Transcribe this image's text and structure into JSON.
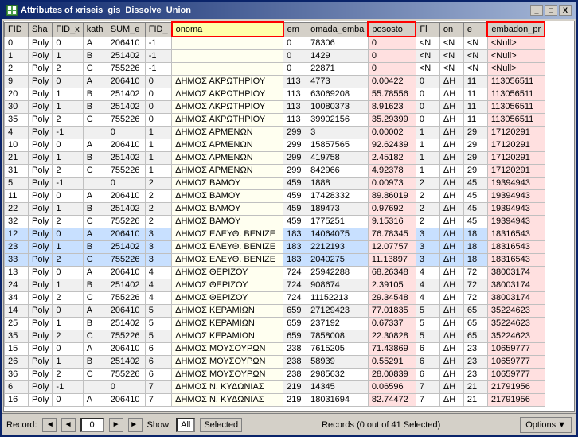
{
  "window": {
    "title": "Attributes of xriseis_gis_Dissolve_Union",
    "icon": "table-icon"
  },
  "title_buttons": {
    "minimize": "_",
    "maximize": "□",
    "close": "X"
  },
  "columns": [
    "FID",
    "Sha",
    "FID_x",
    "kath",
    "SUM_e",
    "FID_",
    "onoma",
    "em",
    "omada_emba",
    "pososto",
    "Fl",
    "on",
    "e",
    "embadon_pr"
  ],
  "rows": [
    [
      0,
      "Poly",
      0,
      "A",
      206410,
      -1,
      "",
      0,
      78306,
      0,
      "<N",
      "<N",
      "<N",
      "<Null>"
    ],
    [
      1,
      "Poly",
      1,
      "B",
      251402,
      -1,
      "",
      0,
      1429,
      0,
      "<N",
      "<N",
      "<N",
      "<Null>"
    ],
    [
      2,
      "Poly",
      2,
      "C",
      755226,
      -1,
      "",
      0,
      22871,
      0,
      "<N",
      "<N",
      "<N",
      "<Null>"
    ],
    [
      9,
      "Poly",
      0,
      "A",
      206410,
      0,
      "ΔΗΜΟΣ ΑΚΡΩΤΗΡΙΟΥ",
      113,
      4773,
      0.00422,
      0,
      "ΔΗ",
      11,
      113056511
    ],
    [
      20,
      "Poly",
      1,
      "B",
      251402,
      0,
      "ΔΗΜΟΣ ΑΚΡΩΤΗΡΙΟΥ",
      113,
      63069208,
      55.78556,
      0,
      "ΔΗ",
      11,
      113056511
    ],
    [
      30,
      "Poly",
      1,
      "B",
      251402,
      0,
      "ΔΗΜΟΣ ΑΚΡΩΤΗΡΙΟΥ",
      113,
      10080373,
      8.91623,
      0,
      "ΔΗ",
      11,
      113056511
    ],
    [
      35,
      "Poly",
      2,
      "C",
      755226,
      0,
      "ΔΗΜΟΣ ΑΚΡΩΤΗΡΙΟΥ",
      113,
      39902156,
      35.29399,
      0,
      "ΔΗ",
      11,
      113056511
    ],
    [
      4,
      "Poly",
      -1,
      "",
      0,
      1,
      "ΔΗΜΟΣ ΑΡΜΕΝΩΝ",
      299,
      3,
      2e-05,
      1,
      "ΔΗ",
      29,
      17120291
    ],
    [
      10,
      "Poly",
      0,
      "A",
      206410,
      1,
      "ΔΗΜΟΣ ΑΡΜΕΝΩΝ",
      299,
      15857565,
      92.62439,
      1,
      "ΔΗ",
      29,
      17120291
    ],
    [
      21,
      "Poly",
      1,
      "B",
      251402,
      1,
      "ΔΗΜΟΣ ΑΡΜΕΝΩΝ",
      299,
      419758,
      2.45182,
      1,
      "ΔΗ",
      29,
      17120291
    ],
    [
      31,
      "Poly",
      2,
      "C",
      755226,
      1,
      "ΔΗΜΟΣ ΑΡΜΕΝΩΝ",
      299,
      842966,
      4.92378,
      1,
      "ΔΗ",
      29,
      17120291
    ],
    [
      5,
      "Poly",
      -1,
      "",
      0,
      2,
      "ΔΗΜΟΣ ΒΑΜΟΥ",
      459,
      1888,
      0.00973,
      2,
      "ΔΗ",
      45,
      19394943
    ],
    [
      11,
      "Poly",
      0,
      "A",
      206410,
      2,
      "ΔΗΜΟΣ ΒΑΜΟΥ",
      459,
      17428332,
      89.86019,
      2,
      "ΔΗ",
      45,
      19394943
    ],
    [
      22,
      "Poly",
      1,
      "B",
      251402,
      2,
      "ΔΗΜΟΣ ΒΑΜΟΥ",
      459,
      189473,
      0.97692,
      2,
      "ΔΗ",
      45,
      19394943
    ],
    [
      32,
      "Poly",
      2,
      "C",
      755226,
      2,
      "ΔΗΜΟΣ ΒΑΜΟΥ",
      459,
      1775251,
      9.15316,
      2,
      "ΔΗ",
      45,
      19394943
    ],
    [
      12,
      "Poly",
      0,
      "A",
      206410,
      3,
      "ΔΗΜΟΣ ΕΛΕΥΘ. ΒΕΝΙΖΕ",
      183,
      14064075,
      76.78345,
      3,
      "ΔΗ",
      18,
      18316543
    ],
    [
      23,
      "Poly",
      1,
      "B",
      251402,
      3,
      "ΔΗΜΟΣ ΕΛΕΥΘ. ΒΕΝΙΖΕ",
      183,
      2212193,
      12.07757,
      3,
      "ΔΗ",
      18,
      18316543
    ],
    [
      33,
      "Poly",
      2,
      "C",
      755226,
      3,
      "ΔΗΜΟΣ ΕΛΕΥΘ. ΒΕΝΙΖΕ",
      183,
      2040275,
      11.13897,
      3,
      "ΔΗ",
      18,
      18316543
    ],
    [
      13,
      "Poly",
      0,
      "A",
      206410,
      4,
      "ΔΗΜΟΣ ΘΕΡΙΖΟΥ",
      724,
      25942288,
      68.26348,
      4,
      "ΔΗ",
      72,
      38003174
    ],
    [
      24,
      "Poly",
      1,
      "B",
      251402,
      4,
      "ΔΗΜΟΣ ΘΕΡΙΖΟΥ",
      724,
      908674,
      2.39105,
      4,
      "ΔΗ",
      72,
      38003174
    ],
    [
      34,
      "Poly",
      2,
      "C",
      755226,
      4,
      "ΔΗΜΟΣ ΘΕΡΙΖΟΥ",
      724,
      11152213,
      29.34548,
      4,
      "ΔΗ",
      72,
      38003174
    ],
    [
      14,
      "Poly",
      0,
      "A",
      206410,
      5,
      "ΔΗΜΟΣ ΚΕΡΑΜΙΩΝ",
      659,
      27129423,
      77.01835,
      5,
      "ΔΗ",
      65,
      35224623
    ],
    [
      25,
      "Poly",
      1,
      "B",
      251402,
      5,
      "ΔΗΜΟΣ ΚΕΡΑΜΙΩΝ",
      659,
      237192,
      0.67337,
      5,
      "ΔΗ",
      65,
      35224623
    ],
    [
      35,
      "Poly",
      2,
      "C",
      755226,
      5,
      "ΔΗΜΟΣ ΚΕΡΑΜΙΩΝ",
      659,
      7858008,
      22.30828,
      5,
      "ΔΗ",
      65,
      35224623
    ],
    [
      15,
      "Poly",
      0,
      "A",
      206410,
      6,
      "ΔΗΜΟΣ ΜΟΥΣΟΥΡΩΝ",
      238,
      7615205,
      71.43869,
      6,
      "ΔΗ",
      23,
      10659777
    ],
    [
      26,
      "Poly",
      1,
      "B",
      251402,
      6,
      "ΔΗΜΟΣ ΜΟΥΣΟΥΡΩΝ",
      238,
      58939,
      0.55291,
      6,
      "ΔΗ",
      23,
      10659777
    ],
    [
      36,
      "Poly",
      2,
      "C",
      755226,
      6,
      "ΔΗΜΟΣ ΜΟΥΣΟΥΡΩΝ",
      238,
      2985632,
      28.00839,
      6,
      "ΔΗ",
      23,
      10659777
    ],
    [
      6,
      "Poly",
      -1,
      "",
      0,
      7,
      "ΔΗΜΟΣ Ν. ΚΥΔΩΝΙΑΣ",
      219,
      14345,
      0.06596,
      7,
      "ΔΗ",
      21,
      21791956
    ],
    [
      16,
      "Poly",
      0,
      "A",
      206410,
      7,
      "ΔΗΜΟΣ Ν. ΚΥΔΩΝΙΑΣ",
      219,
      18031694,
      82.74472,
      7,
      "ΔΗ",
      21,
      21791956
    ]
  ],
  "highlighted_rows": [
    15,
    16,
    17
  ],
  "footer": {
    "record_label": "Record:",
    "record_value": "0",
    "show_label": "Show:",
    "all_label": "All",
    "selected_label": "Selected",
    "records_info": "Records (0 out of 41 Selected)",
    "options_label": "Options"
  }
}
